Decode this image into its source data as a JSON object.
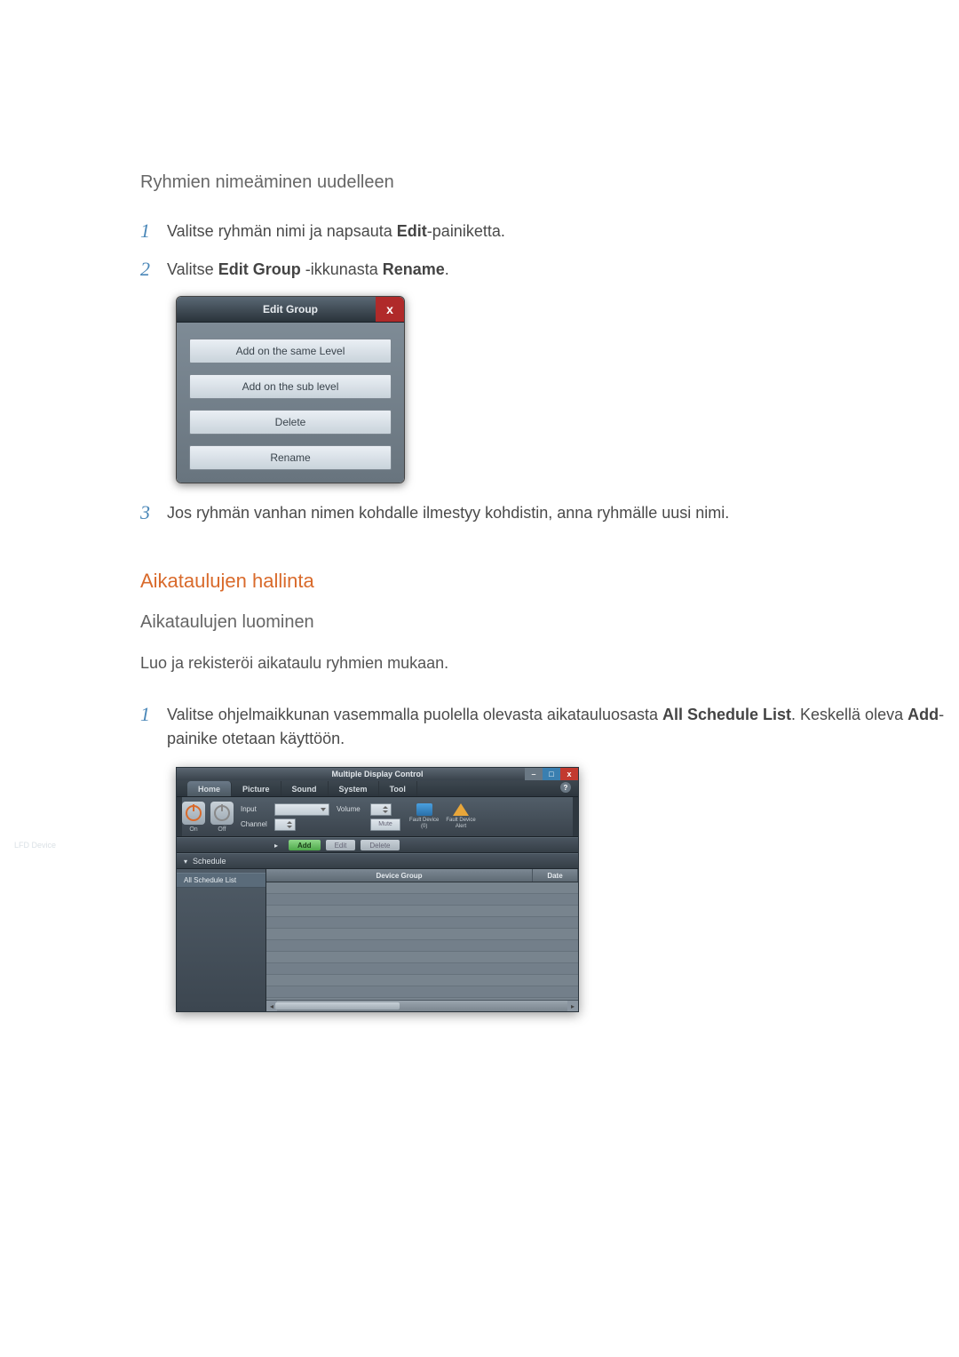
{
  "headings": {
    "rename_groups": "Ryhmien nimeäminen uudelleen",
    "schedules": "Aikataulujen hallinta",
    "create_schedules": "Aikataulujen luominen"
  },
  "body": {
    "create_intro": "Luo ja rekisteröi aikataulu ryhmien mukaan."
  },
  "steps_rename": {
    "s1_pre": "Valitse ryhmän nimi ja napsauta ",
    "s1_b": "Edit",
    "s1_post": "-painiketta.",
    "s2_pre": "Valitse ",
    "s2_b1": "Edit Group",
    "s2_mid": " -ikkunasta ",
    "s2_b2": "Rename",
    "s2_post": ".",
    "s3": "Jos ryhmän vanhan nimen kohdalle ilmestyy kohdistin, anna ryhmälle uusi nimi."
  },
  "steps_schedule": {
    "s1_pre": "Valitse ohjelmaikkunan vasemmalla puolella olevasta aikatauluosasta ",
    "s1_b1": "All Schedule List",
    "s1_mid": ". Keskellä oleva ",
    "s1_b2": "Add",
    "s1_post": "-painike otetaan käyttöön."
  },
  "nums": {
    "n1": "1",
    "n2": "2",
    "n3": "3"
  },
  "dialog": {
    "title": "Edit Group",
    "close": "x",
    "btn_same": "Add on the same Level",
    "btn_sub": "Add on the sub level",
    "btn_del": "Delete",
    "btn_ren": "Rename"
  },
  "mdc": {
    "title": "Multiple Display Control",
    "win": {
      "min": "–",
      "max": "□",
      "close": "x"
    },
    "tabs": {
      "home": "Home",
      "picture": "Picture",
      "sound": "Sound",
      "system": "System",
      "tool": "Tool"
    },
    "help": "?",
    "tb": {
      "on": "On",
      "off": "Off",
      "input": "Input",
      "channel": "Channel",
      "volume": "Volume",
      "mute": "Mute",
      "fault0": "Fault Device",
      "fault0b": "(0)",
      "alert": "Fault Device",
      "alertb": "Alert"
    },
    "sections": {
      "lfd": "LFD Device",
      "schedule": "Schedule"
    },
    "btns": {
      "add": "Add",
      "edit": "Edit",
      "delete": "Delete"
    },
    "side_item": "All Schedule List",
    "grid": {
      "col1": "Device Group",
      "col2": "Date"
    }
  }
}
